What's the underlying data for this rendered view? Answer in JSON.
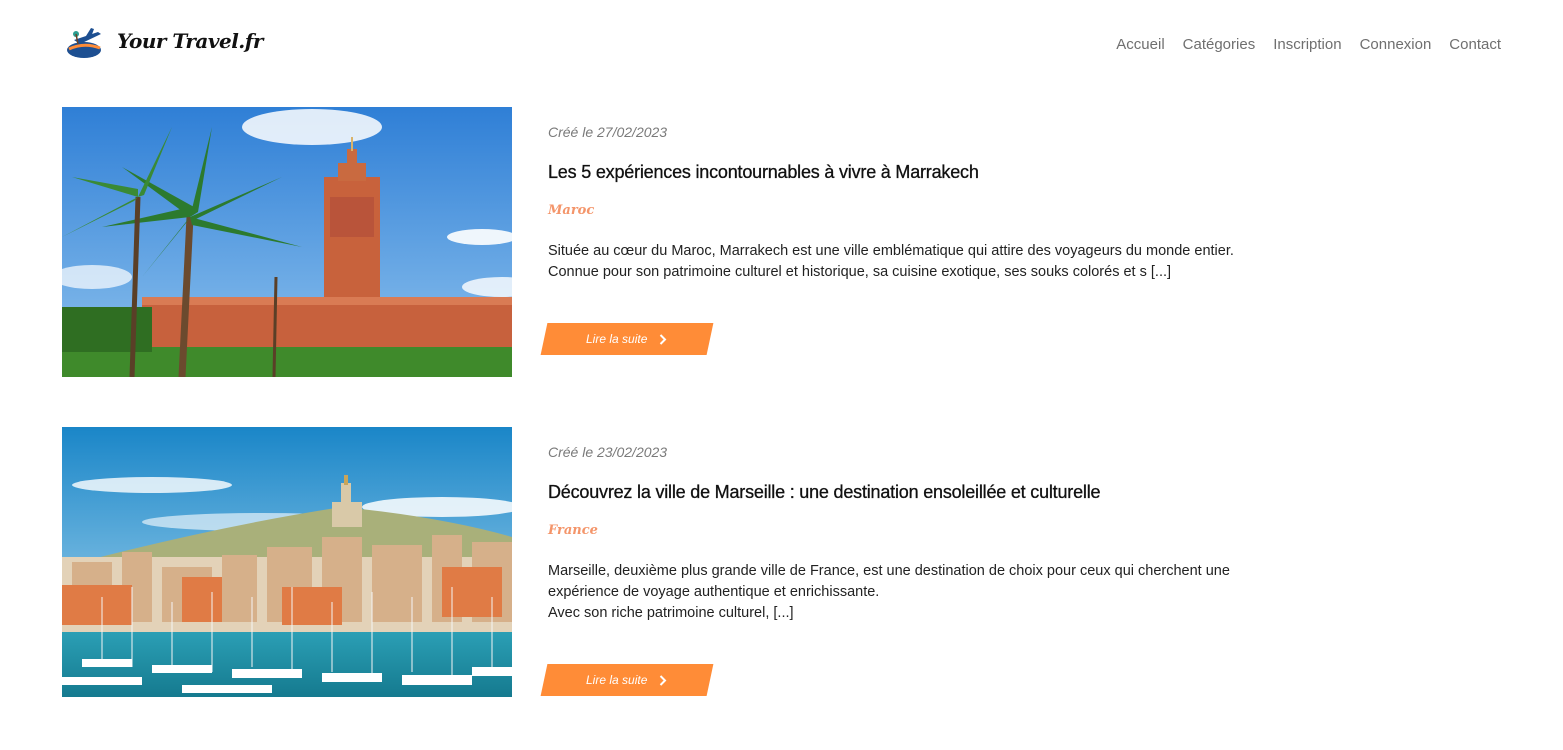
{
  "header": {
    "logo_text": "Your Travel.fr",
    "nav": [
      {
        "label": "Accueil"
      },
      {
        "label": "Catégories"
      },
      {
        "label": "Inscription"
      },
      {
        "label": "Connexion"
      },
      {
        "label": "Contact"
      }
    ]
  },
  "articles": [
    {
      "date": "Créé le 27/02/2023",
      "title": "Les 5 expériences incontournables à vivre à Marrakech",
      "category": "Maroc",
      "excerpt_lines": [
        "Située au cœur du Maroc, Marrakech est une ville emblématique qui attire des voyageurs du monde entier.",
        "Connue pour son patrimoine culturel et historique, sa cuisine exotique, ses souks colorés et s [...]"
      ],
      "read_more": "Lire la suite",
      "image_icon": "marrakech-koutoubia-photo"
    },
    {
      "date": "Créé le 23/02/2023",
      "title": "Découvrez la ville de Marseille : une destination ensoleillée et culturelle",
      "category": "France",
      "excerpt_lines": [
        "Marseille, deuxième plus grande ville de France, est une destination de choix pour ceux qui cherchent une",
        "expérience de voyage authentique et enrichissante.",
        "Avec son riche patrimoine culturel, [...]"
      ],
      "read_more": "Lire la suite",
      "image_icon": "marseille-vieux-port-photo"
    }
  ],
  "colors": {
    "accent_orange": "#ff8c37",
    "category_salmon": "#f4956a",
    "nav_gray": "#6f6f6f"
  }
}
